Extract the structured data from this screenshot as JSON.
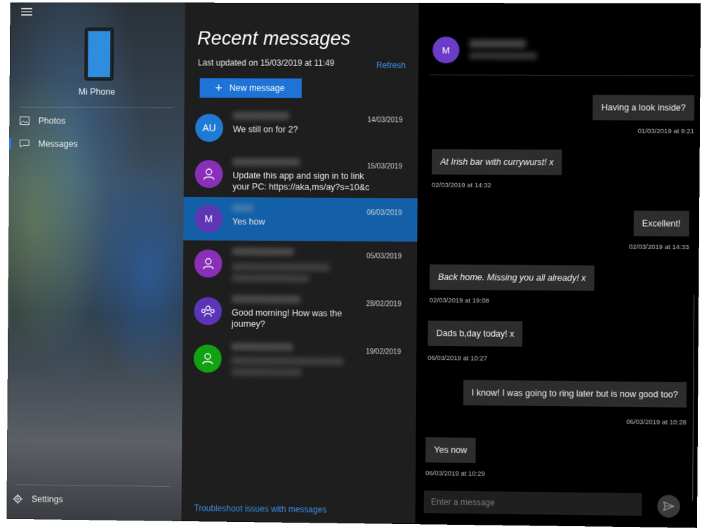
{
  "sidebar": {
    "device_name": "Mi Phone",
    "nav": [
      {
        "label": "Photos",
        "icon": "photos-icon"
      },
      {
        "label": "Messages",
        "icon": "message-icon",
        "active": true
      }
    ],
    "settings_label": "Settings"
  },
  "list": {
    "title": "Recent messages",
    "updated": "Last updated on 15/03/2019 at 11:49",
    "refresh": "Refresh",
    "new_message": "New message",
    "threads": [
      {
        "initials": "AU",
        "avatar_color": "#1f7ad6",
        "date": "14/03/2019",
        "preview": "We still on for 2?"
      },
      {
        "initials": "",
        "avatar_color": "#8a2fb8",
        "date": "15/03/2019",
        "preview": "Update this app and sign in to link\nyour PC: https://aka,ms/ay?s=10&c"
      },
      {
        "initials": "M",
        "avatar_color": "#5d35b5",
        "date": "06/03/2019",
        "preview": "Yes how",
        "selected": true
      },
      {
        "initials": "",
        "avatar_color": "#8a2fb8",
        "date": "05/03/2019",
        "preview": ""
      },
      {
        "initials": "",
        "avatar_color": "#5a35b8",
        "date": "28/02/2019",
        "preview": "Good morning! How was the\njourney?"
      },
      {
        "initials": "",
        "avatar_color": "#12a112",
        "date": "19/02/2019",
        "preview": ""
      }
    ],
    "troubleshoot": "Troubleshoot issues with messages"
  },
  "conversation": {
    "initial": "M",
    "messages": [
      {
        "text": "Having a look inside?",
        "time": "01/03/2019 at 9:21",
        "side": "right"
      },
      {
        "text": "At Irish bar with currywurst! x",
        "time": "02/03/2019 at 14:32",
        "side": "left"
      },
      {
        "text": "Excellent!",
        "time": "02/03/2019 at 14:33",
        "side": "right"
      },
      {
        "text": "Back home. Missing you all already! x",
        "time": "02/03/2019 at 19:08",
        "side": "left"
      },
      {
        "text": "Dads b,day today! x",
        "time": "06/03/2019 at 10:27",
        "side": "left"
      },
      {
        "text": "I know! I was going to ring later but is now good too?",
        "time": "06/03/2019 at 10:28",
        "side": "right"
      },
      {
        "text": "Yes now",
        "time": "06/03/2019 at 10:29",
        "side": "left"
      }
    ],
    "input_placeholder": "Enter a message"
  }
}
